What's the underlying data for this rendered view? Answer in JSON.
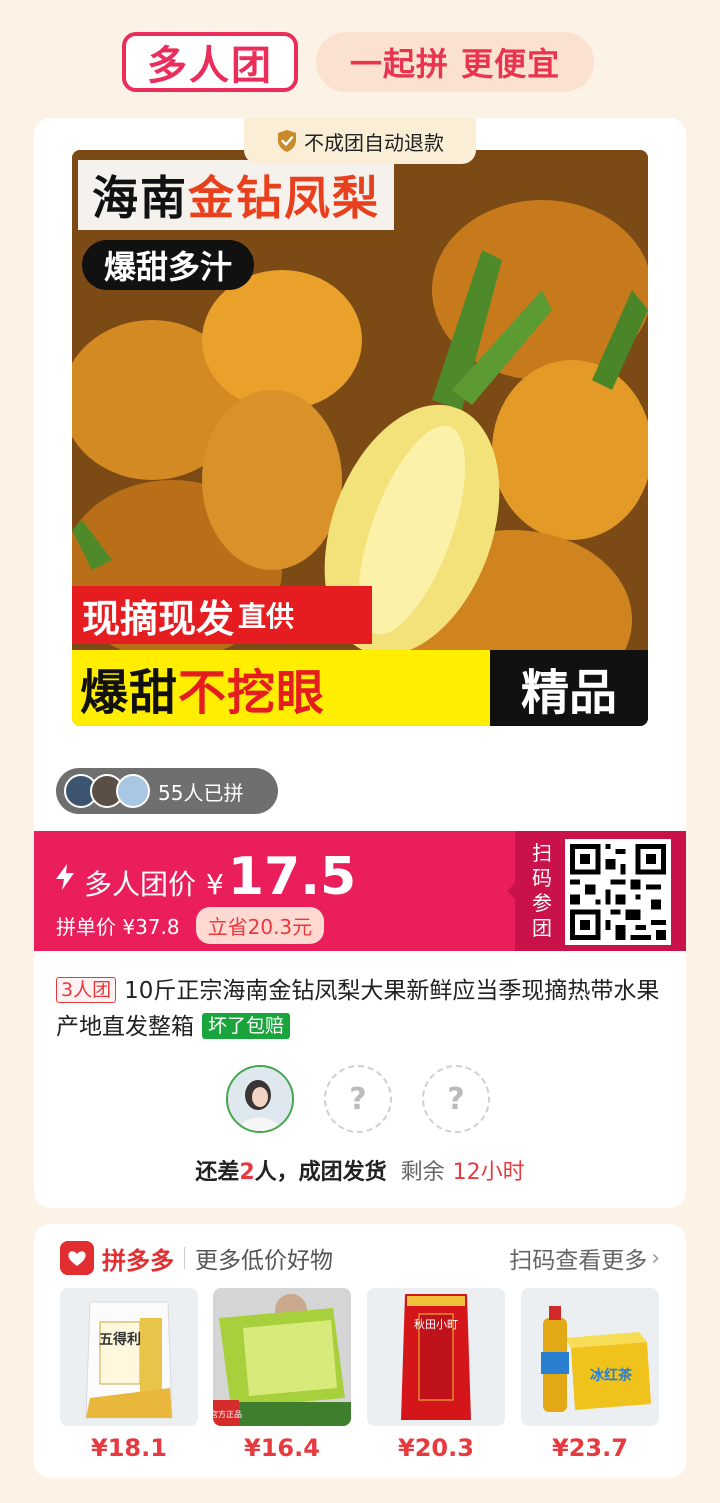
{
  "header": {
    "logo_text": "多人团",
    "slogan": "一起拼 更便宜"
  },
  "product": {
    "refund_badge": "不成团自动退款",
    "image_text": {
      "title_black": "海南",
      "title_red": "金钻凤梨",
      "subtitle": "爆甜多汁",
      "red_banner": "现摘现发",
      "red_banner_small": "直供",
      "bottom_black": "爆甜",
      "bottom_red": "不挖眼",
      "bottom_right": "精品"
    },
    "joined_count": "55人已拼",
    "group_price_label": "多人团价",
    "currency": "¥",
    "group_price": "17.5",
    "single_price": "拼单价 ¥37.8",
    "save_text": "立省20.3元",
    "scan_label": "扫码参团",
    "group_tag": "3人团",
    "title": "10斤正宗海南金钻凤梨大果新鲜应当季现摘热带水果产地直发整箱",
    "guarantee_tag": "坏了包赔",
    "empty_slot_symbol": "?",
    "status": {
      "prefix": "还差",
      "count": "2",
      "suffix": "人，成团发货",
      "remaining_label": "剩余",
      "remaining_time": "12小时"
    }
  },
  "more": {
    "brand": "拼多多",
    "tagline": "更多低价好物",
    "link": "扫码查看更多",
    "items": [
      {
        "price": "¥18.1",
        "image_text": "五得利"
      },
      {
        "price": "¥16.4",
        "image_text": "官方正品"
      },
      {
        "price": "¥20.3",
        "image_text": "秋田小町"
      },
      {
        "price": "¥23.7",
        "image_text": "冰红茶"
      }
    ]
  },
  "colors": {
    "brand_pink": "#eb1e5c",
    "brand_red": "#e8393f",
    "background": "#fdf2e6"
  }
}
